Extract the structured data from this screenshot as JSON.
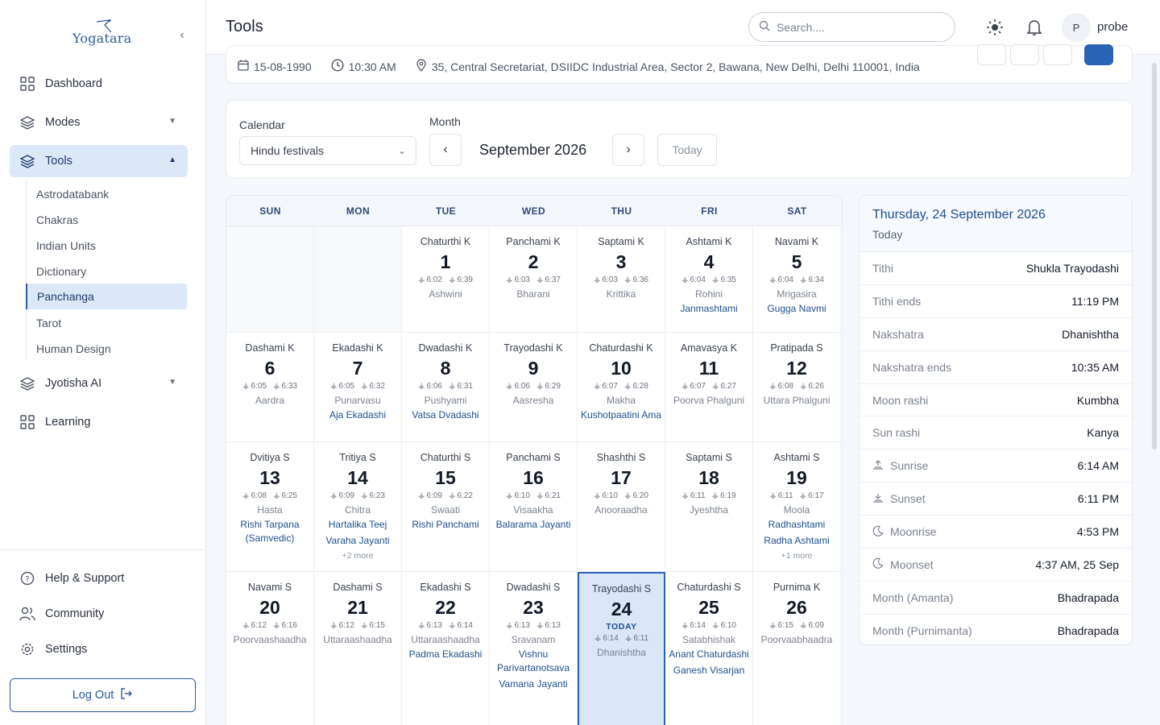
{
  "brand": {
    "logo_text": "Yogatara"
  },
  "sidebar": {
    "items": [
      {
        "label": "Dashboard"
      },
      {
        "label": "Modes"
      },
      {
        "label": "Tools"
      },
      {
        "label": "Jyotisha AI"
      },
      {
        "label": "Learning"
      }
    ],
    "tools_sub": [
      "Astrodatabank",
      "Chakras",
      "Indian Units",
      "Dictionary",
      "Panchanga",
      "Tarot",
      "Human Design"
    ],
    "bottom": [
      {
        "label": "Help & Support"
      },
      {
        "label": "Community"
      },
      {
        "label": "Settings"
      }
    ],
    "logout": "Log Out"
  },
  "header": {
    "title": "Tools",
    "search_placeholder": "Search....",
    "avatar_initial": "P",
    "user": "probe"
  },
  "info": {
    "date": "15-08-1990",
    "time": "10:30 AM",
    "location": "35, Central Secretariat, DSIIDC Industrial Area, Sector 2, Bawana, New Delhi, Delhi 110001, India"
  },
  "controls": {
    "calendar_label": "Calendar",
    "calendar_value": "Hindu festivals",
    "month_label": "Month",
    "month_value": "September 2026",
    "today_button": "Today"
  },
  "calendar": {
    "weekdays": [
      "SUN",
      "MON",
      "TUE",
      "WED",
      "THU",
      "FRI",
      "SAT"
    ],
    "today_tag": "TODAY",
    "days": [
      {
        "d": "1",
        "tithi": "Chaturthi K",
        "rise": "6:02",
        "set": "6:39",
        "nak": "Ashwini",
        "fest": []
      },
      {
        "d": "2",
        "tithi": "Panchami K",
        "rise": "6:03",
        "set": "6:37",
        "nak": "Bharani",
        "fest": []
      },
      {
        "d": "3",
        "tithi": "Saptami K",
        "rise": "6:03",
        "set": "6:36",
        "nak": "Krittika",
        "fest": []
      },
      {
        "d": "4",
        "tithi": "Ashtami K",
        "rise": "6:04",
        "set": "6:35",
        "nak": "Rohini",
        "fest": [
          "Janmashtami"
        ]
      },
      {
        "d": "5",
        "tithi": "Navami K",
        "rise": "6:04",
        "set": "6:34",
        "nak": "Mrigasira",
        "fest": [
          "Gugga Navmi"
        ]
      },
      {
        "d": "6",
        "tithi": "Dashami K",
        "rise": "6:05",
        "set": "6:33",
        "nak": "Aardra",
        "fest": []
      },
      {
        "d": "7",
        "tithi": "Ekadashi K",
        "rise": "6:05",
        "set": "6:32",
        "nak": "Punarvasu",
        "fest": [
          "Aja Ekadashi"
        ]
      },
      {
        "d": "8",
        "tithi": "Dwadashi K",
        "rise": "6:06",
        "set": "6:31",
        "nak": "Pushyami",
        "fest": [
          "Vatsa Dvadashi"
        ]
      },
      {
        "d": "9",
        "tithi": "Trayodashi K",
        "rise": "6:06",
        "set": "6:29",
        "nak": "Aasresha",
        "fest": []
      },
      {
        "d": "10",
        "tithi": "Chaturdashi K",
        "rise": "6:07",
        "set": "6:28",
        "nak": "Makha",
        "fest": [
          "Kushotpaatini Ama"
        ]
      },
      {
        "d": "11",
        "tithi": "Amavasya K",
        "rise": "6:07",
        "set": "6:27",
        "nak": "Poorva Phalguni",
        "fest": []
      },
      {
        "d": "12",
        "tithi": "Pratipada S",
        "rise": "6:08",
        "set": "6:26",
        "nak": "Uttara Phalguni",
        "fest": []
      },
      {
        "d": "13",
        "tithi": "Dvitiya S",
        "rise": "6:08",
        "set": "6:25",
        "nak": "Hasta",
        "fest": [
          "Rishi Tarpana (Samvedic)"
        ]
      },
      {
        "d": "14",
        "tithi": "Tritiya S",
        "rise": "6:09",
        "set": "6:23",
        "nak": "Chitra",
        "fest": [
          "Hartalika Teej",
          "Varaha Jayanti"
        ],
        "more": "+2 more"
      },
      {
        "d": "15",
        "tithi": "Chaturthi S",
        "rise": "6:09",
        "set": "6:22",
        "nak": "Swaati",
        "fest": [
          "Rishi Panchami"
        ]
      },
      {
        "d": "16",
        "tithi": "Panchami S",
        "rise": "6:10",
        "set": "6:21",
        "nak": "Visaakha",
        "fest": [
          "Balarama Jayanti"
        ]
      },
      {
        "d": "17",
        "tithi": "Shashthi S",
        "rise": "6:10",
        "set": "6:20",
        "nak": "Anooraadha",
        "fest": []
      },
      {
        "d": "18",
        "tithi": "Saptami S",
        "rise": "6:11",
        "set": "6:19",
        "nak": "Jyeshtha",
        "fest": []
      },
      {
        "d": "19",
        "tithi": "Ashtami S",
        "rise": "6:11",
        "set": "6:17",
        "nak": "Moola",
        "fest": [
          "Radhashtami",
          "Radha Ashtami"
        ],
        "more": "+1 more"
      },
      {
        "d": "20",
        "tithi": "Navami S",
        "rise": "6:12",
        "set": "6:16",
        "nak": "Poorvaashaadha",
        "fest": []
      },
      {
        "d": "21",
        "tithi": "Dashami S",
        "rise": "6:12",
        "set": "6:15",
        "nak": "Uttaraashaadha",
        "fest": []
      },
      {
        "d": "22",
        "tithi": "Ekadashi S",
        "rise": "6:13",
        "set": "6:14",
        "nak": "Uttaraashaadha",
        "fest": [
          "Padma Ekadashi"
        ]
      },
      {
        "d": "23",
        "tithi": "Dwadashi S",
        "rise": "6:13",
        "set": "6:13",
        "nak": "Sravanam",
        "fest": [
          "Vishnu Parivartanotsava",
          "Vamana Jayanti"
        ]
      },
      {
        "d": "24",
        "tithi": "Trayodashi S",
        "rise": "6:14",
        "set": "6:11",
        "nak": "Dhanishtha",
        "fest": [],
        "today": true
      },
      {
        "d": "25",
        "tithi": "Chaturdashi S",
        "rise": "6:14",
        "set": "6:10",
        "nak": "Satabhishak",
        "fest": [
          "Anant Chaturdashi",
          "Ganesh Visarjan"
        ]
      },
      {
        "d": "26",
        "tithi": "Purnima K",
        "rise": "6:15",
        "set": "6:09",
        "nak": "Poorvaabhaadra",
        "fest": []
      }
    ]
  },
  "detail": {
    "title": "Thursday, 24 September 2026",
    "subtitle": "Today",
    "rows": [
      {
        "k": "Tithi",
        "v": "Shukla Trayodashi"
      },
      {
        "k": "Tithi ends",
        "v": "11:19 PM"
      },
      {
        "k": "Nakshatra",
        "v": "Dhanishtha"
      },
      {
        "k": "Nakshatra ends",
        "v": "10:35 AM"
      },
      {
        "k": "Moon rashi",
        "v": "Kumbha"
      },
      {
        "k": "Sun rashi",
        "v": "Kanya"
      },
      {
        "k": "Sunrise",
        "v": "6:14 AM",
        "icon": "sunrise-icon"
      },
      {
        "k": "Sunset",
        "v": "6:11 PM",
        "icon": "sunset-icon"
      },
      {
        "k": "Moonrise",
        "v": "4:53 PM",
        "icon": "moon-icon"
      },
      {
        "k": "Moonset",
        "v": "4:37 AM, 25 Sep",
        "icon": "moon-icon"
      },
      {
        "k": "Month (Amanta)",
        "v": "Bhadrapada"
      },
      {
        "k": "Month (Purnimanta)",
        "v": "Bhadrapada"
      }
    ]
  }
}
